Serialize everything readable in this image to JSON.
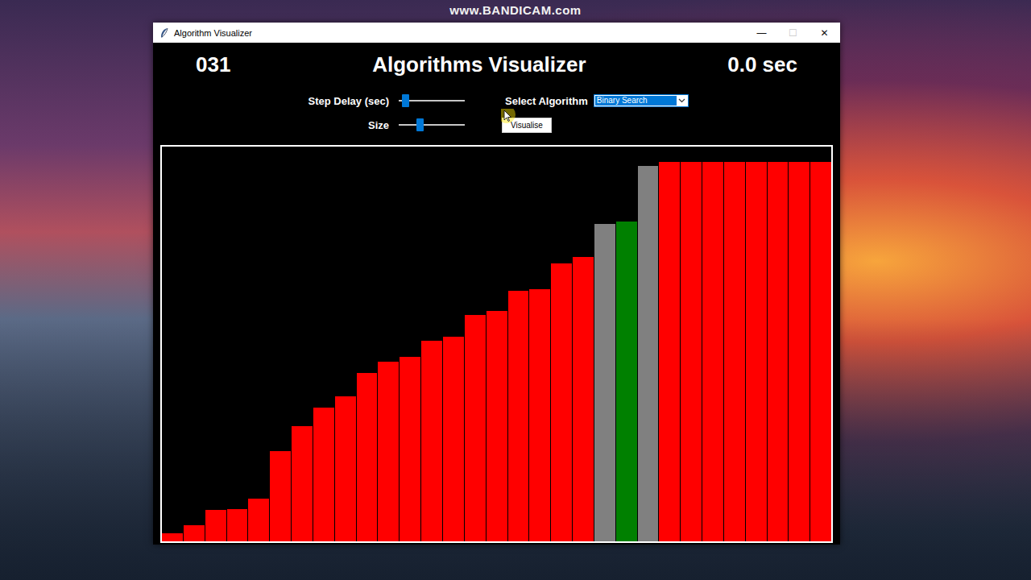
{
  "watermark": "www.BANDICAM.com",
  "window": {
    "title": "Algorithm Visualizer",
    "controls": [
      {
        "label": "—",
        "disabled": false
      },
      {
        "label": "☐",
        "disabled": true
      },
      {
        "label": "✕",
        "disabled": false
      }
    ]
  },
  "header": {
    "count": "031",
    "title": "Algorithms Visualizer",
    "time": "0.0 sec"
  },
  "controls": {
    "step_delay": {
      "label": "Step Delay (sec)",
      "level": 0.05
    },
    "size": {
      "label": "Size",
      "level": 0.3
    },
    "algorithm": {
      "label": "Select Algorithm",
      "value": "Binary Search"
    },
    "button": {
      "label": "Visualise"
    }
  },
  "chart": {
    "max": 490,
    "bars": [
      {
        "value": 10,
        "color": "#ff0000"
      },
      {
        "value": 20,
        "color": "#ff0000"
      },
      {
        "value": 39,
        "color": "#ff0000"
      },
      {
        "value": 40,
        "color": "#ff0000"
      },
      {
        "value": 53,
        "color": "#ff0000"
      },
      {
        "value": 113,
        "color": "#ff0000"
      },
      {
        "value": 144,
        "color": "#ff0000"
      },
      {
        "value": 167,
        "color": "#ff0000"
      },
      {
        "value": 182,
        "color": "#ff0000"
      },
      {
        "value": 211,
        "color": "#ff0000"
      },
      {
        "value": 225,
        "color": "#ff0000"
      },
      {
        "value": 231,
        "color": "#ff0000"
      },
      {
        "value": 251,
        "color": "#ff0000"
      },
      {
        "value": 256,
        "color": "#ff0000"
      },
      {
        "value": 283,
        "color": "#ff0000"
      },
      {
        "value": 288,
        "color": "#ff0000"
      },
      {
        "value": 314,
        "color": "#ff0000"
      },
      {
        "value": 316,
        "color": "#ff0000"
      },
      {
        "value": 348,
        "color": "#ff0000"
      },
      {
        "value": 356,
        "color": "#ff0000"
      },
      {
        "value": 397,
        "color": "#808080"
      },
      {
        "value": 400,
        "color": "#008000"
      },
      {
        "value": 470,
        "color": "#808080"
      },
      {
        "value": 475,
        "color": "#ff0000"
      },
      {
        "value": 475,
        "color": "#ff0000"
      },
      {
        "value": 475,
        "color": "#ff0000"
      },
      {
        "value": 475,
        "color": "#ff0000"
      },
      {
        "value": 475,
        "color": "#ff0000"
      },
      {
        "value": 475,
        "color": "#ff0000"
      },
      {
        "value": 475,
        "color": "#ff0000"
      },
      {
        "value": 475,
        "color": "#ff0000"
      }
    ]
  }
}
